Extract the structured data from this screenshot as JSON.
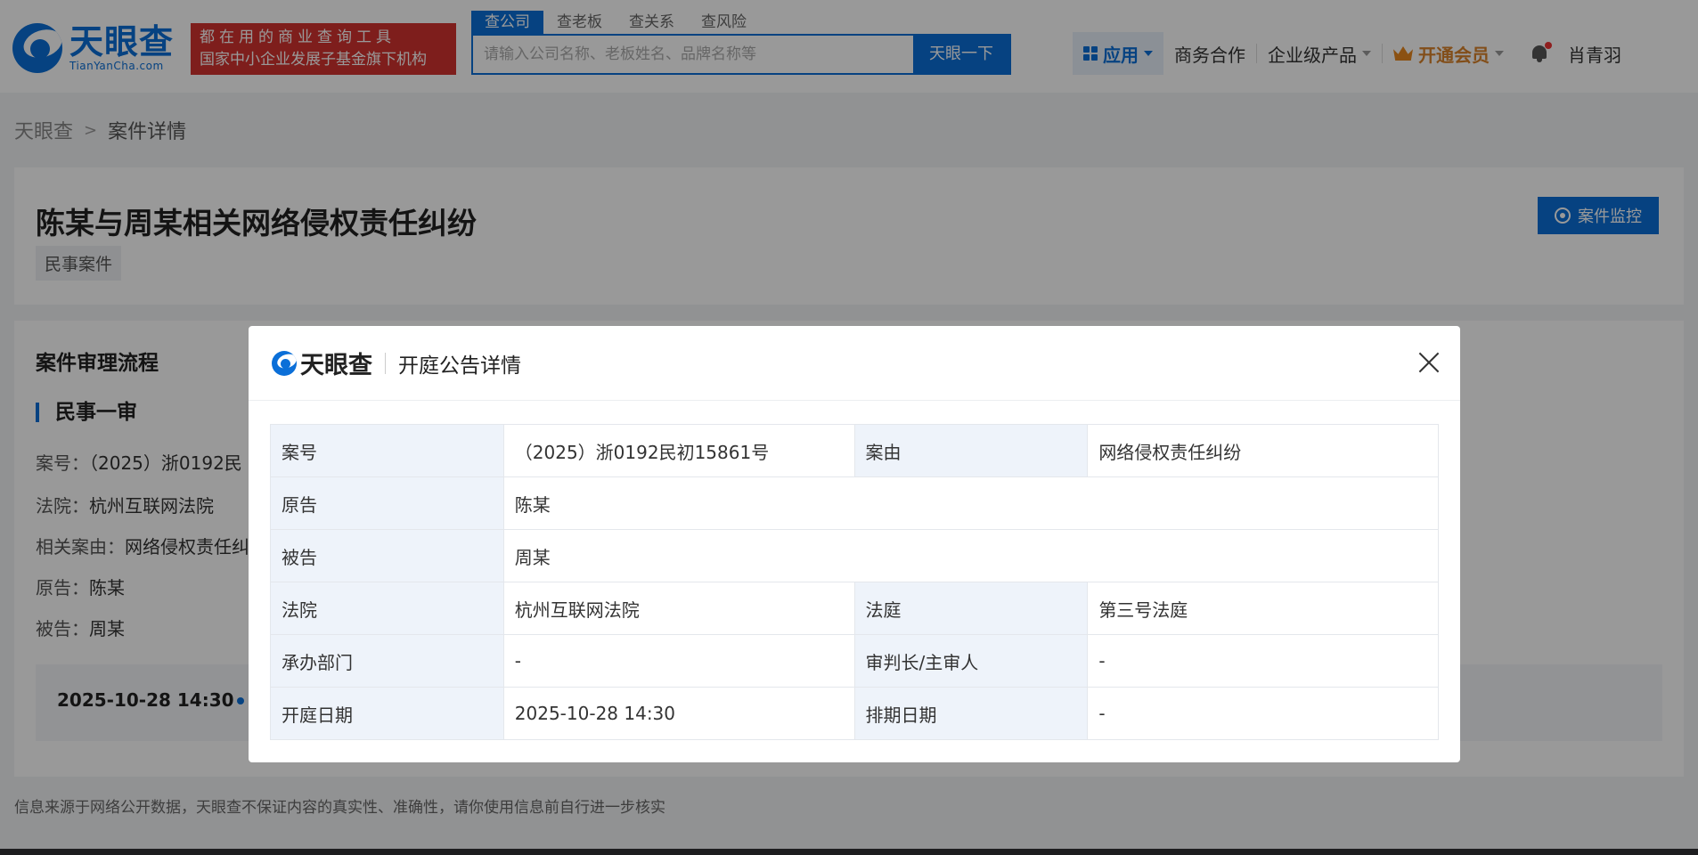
{
  "header": {
    "logo_cn": "天眼查",
    "logo_en": "TianYanCha.com",
    "promo_line1": "都在用的商业查询工具",
    "promo_line2": "国家中小企业发展子基金旗下机构",
    "search_tabs": [
      "查公司",
      "查老板",
      "查关系",
      "查风险"
    ],
    "search_placeholder": "请输入公司名称、老板姓名、品牌名称等",
    "search_button": "天眼一下",
    "nav_apps": "应用",
    "nav_business": "商务合作",
    "nav_enterprise": "企业级产品",
    "nav_vip": "开通会员",
    "user_name": "肖青羽"
  },
  "breadcrumb": {
    "home": "天眼查",
    "current": "案件详情"
  },
  "case": {
    "title": "陈某与周某相关网络侵权责任纠纷",
    "tag": "民事案件",
    "monitor_button": "案件监控"
  },
  "process": {
    "title": "案件审理流程",
    "stage": "民事一审",
    "case_no_label": "案号：",
    "case_no_value": "（2025）浙0192民",
    "court_label": "法院：",
    "court_value": "杭州互联网法院",
    "cause_label": "相关案由：",
    "cause_value": "网络侵权责任纠",
    "plaintiff_label": "原告：",
    "plaintiff_value": "陈某",
    "defendant_label": "被告：",
    "defendant_value": "周某",
    "timeline_date": "2025-10-28 14:30"
  },
  "disclaimer": "信息来源于网络公开数据，天眼查不保证内容的真实性、准确性，请你使用信息前自行进一步核实",
  "modal": {
    "logo_text": "天眼查",
    "title": "开庭公告详情",
    "rows": {
      "case_no_label": "案号",
      "case_no_value": "（2025）浙0192民初15861号",
      "cause_label": "案由",
      "cause_value": "网络侵权责任纠纷",
      "plaintiff_label": "原告",
      "plaintiff_value": "陈某",
      "defendant_label": "被告",
      "defendant_value": "周某",
      "court_label": "法院",
      "court_value": "杭州互联网法院",
      "courtroom_label": "法庭",
      "courtroom_value": "第三号法庭",
      "dept_label": "承办部门",
      "dept_value": "-",
      "judge_label": "审判长/主审人",
      "judge_value": "-",
      "hearing_date_label": "开庭日期",
      "hearing_date_value": "2025-10-28 14:30",
      "schedule_date_label": "排期日期",
      "schedule_date_value": "-"
    }
  },
  "colors": {
    "brand": "#0b6fd8",
    "promo": "#d2332f",
    "vip": "#d9822b"
  }
}
